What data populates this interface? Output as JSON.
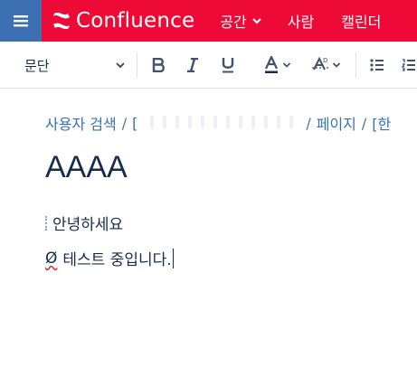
{
  "header": {
    "brand": "Confluence",
    "nav": [
      {
        "label": "공간",
        "has_dropdown": true
      },
      {
        "label": "사람",
        "has_dropdown": false
      },
      {
        "label": "캘린더",
        "has_dropdown": false
      }
    ],
    "colors": {
      "bar": "#ee0a37",
      "menu_button": "#3d6fb3"
    }
  },
  "toolbar": {
    "paragraph_style": "문단",
    "buttons": [
      "bold-icon",
      "italic-icon",
      "underline-icon",
      "text-color-icon",
      "text-style-icon",
      "bullet-list-icon",
      "numbered-list-icon"
    ]
  },
  "page": {
    "breadcrumb": {
      "user_search": "사용자 검색",
      "sep1": "/",
      "redacted_prefix": "[",
      "sep2": "/",
      "pages": "페이지",
      "sep3": "/",
      "last_prefix": "[한"
    },
    "title": "AAAA",
    "body": [
      {
        "text": "안녕하세요"
      },
      {
        "prefix": "Ø",
        "text": "테스트 중입니다."
      }
    ]
  }
}
